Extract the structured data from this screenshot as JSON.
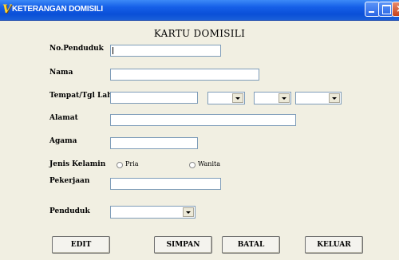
{
  "window": {
    "title": "KETERANGAN DOMISILI",
    "icon": "app-logo-icon"
  },
  "form": {
    "heading": "KARTU DOMISILI",
    "labels": {
      "no_penduduk": "No.Penduduk",
      "nama": "Nama",
      "tempat_tgl_lahir": "Tempat/Tgl Lahir",
      "alamat": "Alamat",
      "agama": "Agama",
      "jenis_kelamin": "Jenis Kelamin",
      "pekerjaan": "Pekerjaan",
      "penduduk": "Penduduk"
    },
    "values": {
      "no_penduduk": "",
      "nama": "",
      "tempat_lahir": "",
      "tgl_day": "",
      "tgl_month": "",
      "tgl_year": "",
      "alamat": "",
      "agama": "",
      "pekerjaan": "",
      "penduduk": ""
    },
    "gender_options": [
      "Pria",
      "Wanita"
    ]
  },
  "buttons": {
    "edit": "EDIT",
    "simpan": "SIMPAN",
    "batal": "BATAL",
    "keluar": "KELUAR"
  },
  "colors": {
    "titlebar": "#0a4fd8",
    "window_bg": "#f1efe2",
    "field_border": "#7f9db9"
  }
}
